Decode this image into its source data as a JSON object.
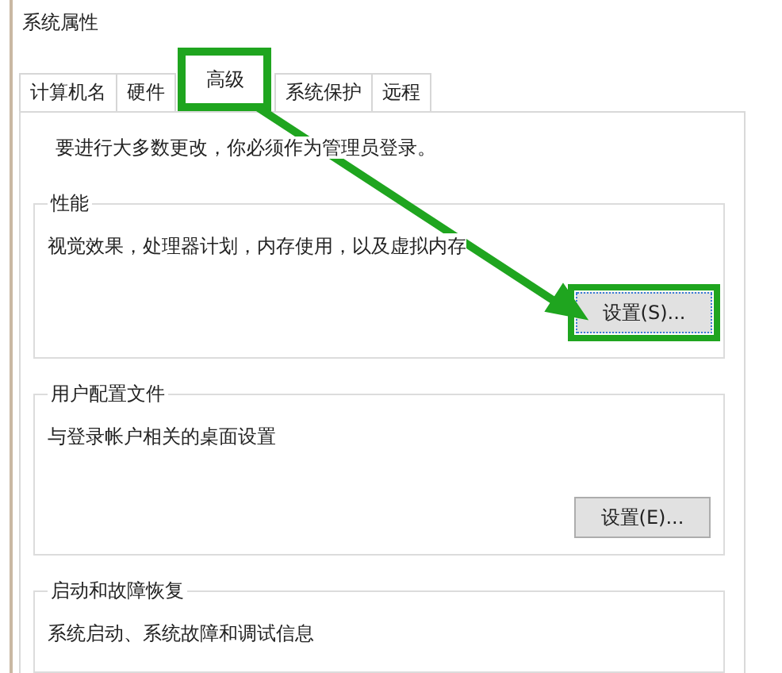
{
  "window": {
    "title": "系统属性"
  },
  "tabs": [
    {
      "label": "计算机名",
      "selected": false,
      "highlighted": false
    },
    {
      "label": "硬件",
      "selected": false,
      "highlighted": false
    },
    {
      "label": "高级",
      "selected": true,
      "highlighted": true
    },
    {
      "label": "系统保护",
      "selected": false,
      "highlighted": false
    },
    {
      "label": "远程",
      "selected": false,
      "highlighted": false
    }
  ],
  "notice": "要进行大多数更改，你必须作为管理员登录。",
  "groups": [
    {
      "title": "性能",
      "description": "视觉效果，处理器计划，内存使用，以及虚拟内存",
      "button": {
        "label": "设置(S)...",
        "highlighted": true
      }
    },
    {
      "title": "用户配置文件",
      "description": "与登录帐户相关的桌面设置",
      "button": {
        "label": "设置(E)...",
        "highlighted": false
      }
    },
    {
      "title": "启动和故障恢复",
      "description": "系统启动、系统故障和调试信息"
    }
  ],
  "annotation": {
    "kind": "arrow"
  }
}
